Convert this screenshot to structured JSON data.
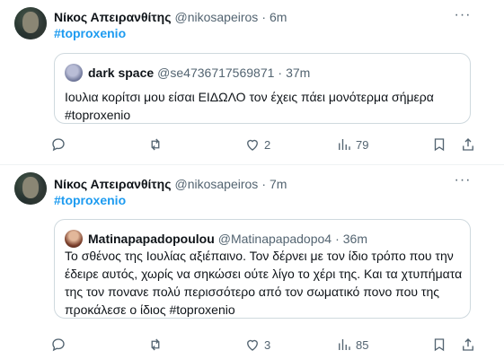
{
  "tweets": [
    {
      "author_name": "Νίκος Απειρανθίτης",
      "author_handle": "@nikosapeiros",
      "separator": "·",
      "time": "6m",
      "hashtag": "#toproxenio",
      "quote": {
        "author_name": "dark space",
        "author_handle": "@se4736717569871",
        "separator": "·",
        "time": "37m",
        "text": "Ιουλια κορίτσι μου είσαι ΕΙΔΩΛΟ τον έχεις πάει μονότερμα σήμερα #toproxenio"
      },
      "actions": {
        "reply": "",
        "retweet": "",
        "likes": "2",
        "views": "79"
      }
    },
    {
      "author_name": "Νίκος Απειρανθίτης",
      "author_handle": "@nikosapeiros",
      "separator": "·",
      "time": "7m",
      "hashtag": "#toproxenio",
      "quote": {
        "author_name": "Matinapapadopoulou",
        "author_handle": "@Matinapapadopo4",
        "separator": "·",
        "time": "36m",
        "text": "Το σθένος της Ιουλίας αξιέπαινο. Τον δέρνει με τον ίδιο τρόπο που την έδειρε αυτός, χωρίς να σηκώσει ούτε λίγο το χέρι της. Και τα χτυπήματα της τον πονανε πολύ περισσότερο από τον σωματικό πονο που της προκάλεσε ο ίδιος #toproxenio"
      },
      "actions": {
        "reply": "",
        "retweet": "",
        "likes": "3",
        "views": "85"
      }
    }
  ],
  "icons": {
    "more": "more-icon",
    "reply": "reply-icon",
    "retweet": "retweet-icon",
    "like": "heart-icon",
    "views": "views-icon",
    "bookmark": "bookmark-icon",
    "share": "share-icon"
  },
  "colors": {
    "accent": "#1d9bf0",
    "text": "#0f1419",
    "muted": "#536471",
    "border": "#cfd9de"
  }
}
